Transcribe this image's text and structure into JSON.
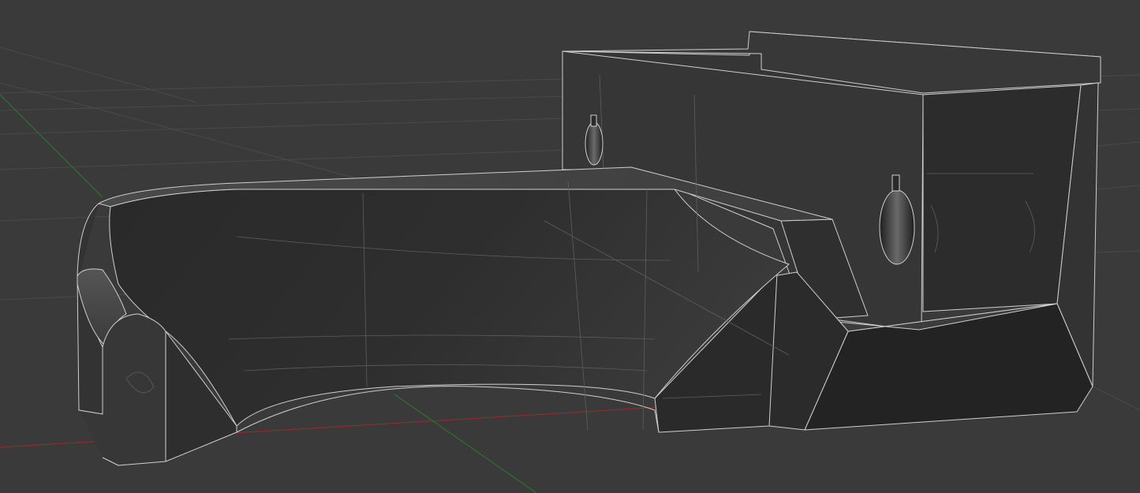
{
  "viewport": {
    "background_color": "#3a3a3a",
    "grid_color": "#4a4a4a",
    "grid_major_color": "#555555",
    "x_axis_color": "#9a2b2b",
    "y_axis_color": "#2f7a2f",
    "edge_color": "#cfcfcf",
    "hidden_edge_color": "#5e5e5e"
  },
  "model": {
    "face_shades": {
      "dark": "#262626",
      "medium": "#303030",
      "light": "#3c3c3c",
      "highlight": "#4a4a4a",
      "top": "#363636"
    },
    "visible_holes": 2
  }
}
